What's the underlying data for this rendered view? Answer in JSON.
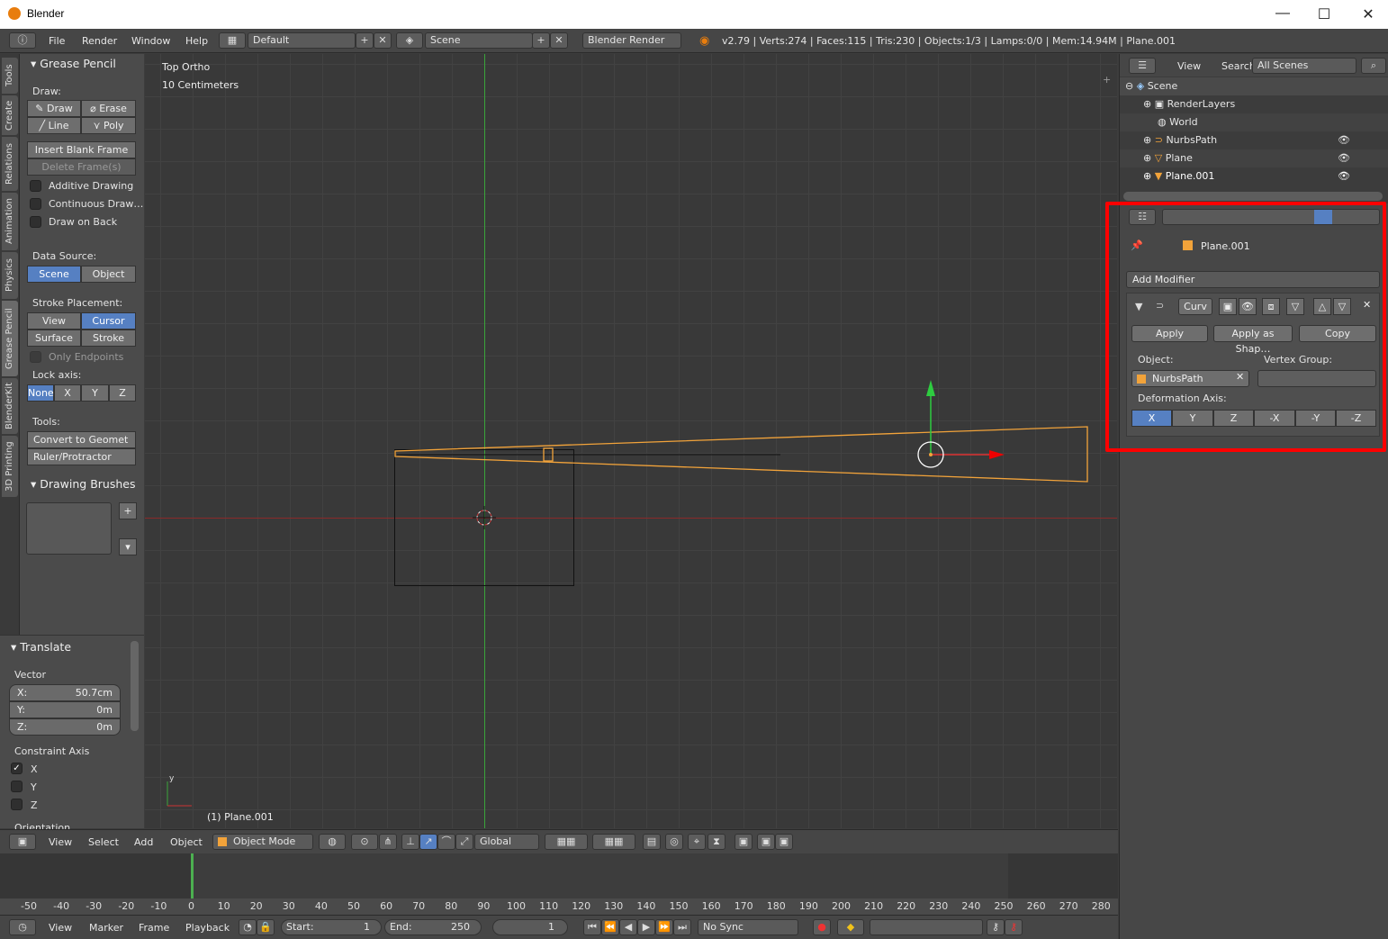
{
  "window": {
    "title": "Blender",
    "min": "—",
    "max": "☐",
    "close": "✕"
  },
  "info": {
    "menus": [
      "File",
      "Render",
      "Window",
      "Help"
    ],
    "layout": "Default",
    "scene": "Scene",
    "engine": "Blender Render",
    "stats": "v2.79 | Verts:274 | Faces:115 | Tris:230 | Objects:1/3 | Lamps:0/0 | Mem:14.94M | Plane.001"
  },
  "tabs": [
    "Tools",
    "Create",
    "Relations",
    "Animation",
    "Physics",
    "Grease Pencil",
    "BlenderKit",
    "3D Printing"
  ],
  "grease": {
    "title": "Grease Pencil",
    "draw_label": "Draw:",
    "draw": "Draw",
    "erase": "Erase",
    "line": "Line",
    "poly": "Poly",
    "insert": "Insert Blank Frame",
    "delete": "Delete Frame(s)",
    "additive": "Additive Drawing",
    "continuous": "Continuous Draw…",
    "drawback": "Draw on Back",
    "datasource": "Data Source:",
    "scene": "Scene",
    "object": "Object",
    "placement": "Stroke Placement:",
    "view": "View",
    "cursor": "Cursor",
    "surface": "Surface",
    "stroke": "Stroke",
    "endpoints": "Only Endpoints",
    "lockaxis": "Lock axis:",
    "none": "None",
    "x": "X",
    "y": "Y",
    "z": "Z",
    "tools": "Tools:",
    "convert": "Convert to Geomet",
    "ruler": "Ruler/Protractor",
    "brushes": "Drawing Brushes"
  },
  "translate": {
    "title": "Translate",
    "vector": "Vector",
    "x": "X:",
    "xv": "50.7cm",
    "y": "Y:",
    "yv": "0m",
    "z": "Z:",
    "zv": "0m",
    "constraint": "Constraint Axis",
    "cx": "X",
    "cy": "Y",
    "cz": "Z",
    "orient": "Orientation"
  },
  "viewport": {
    "view": "Top Ortho",
    "scale": "10 Centimeters",
    "obj": "(1) Plane.001",
    "axis_y": "y"
  },
  "vphead": {
    "menus": [
      "View",
      "Select",
      "Add",
      "Object"
    ],
    "mode": "Object Mode",
    "orient": "Global"
  },
  "timeline": {
    "ticks": [
      "-50",
      "-40",
      "-30",
      "-20",
      "-10",
      "0",
      "10",
      "20",
      "30",
      "40",
      "50",
      "60",
      "70",
      "80",
      "90",
      "100",
      "110",
      "120",
      "130",
      "140",
      "150",
      "160",
      "170",
      "180",
      "190",
      "200",
      "210",
      "220",
      "230",
      "240",
      "250",
      "260",
      "270",
      "280"
    ],
    "menus": [
      "View",
      "Marker",
      "Frame",
      "Playback"
    ],
    "start": "Start:",
    "startv": "1",
    "end": "End:",
    "endv": "250",
    "cur": "1",
    "sync": "No Sync"
  },
  "outliner": {
    "view": "View",
    "search": "Search",
    "scenes": "All Scenes",
    "rows": [
      "Scene",
      "RenderLayers",
      "World",
      "NurbsPath",
      "Plane",
      "Plane.001"
    ]
  },
  "props": {
    "obj": "Plane.001",
    "add": "Add Modifier",
    "modname": "Curv",
    "apply": "Apply",
    "applyshape": "Apply as Shap…",
    "copy": "Copy",
    "object": "Object:",
    "vgroup": "Vertex Group:",
    "objval": "NurbsPath",
    "deform": "Deformation Axis:",
    "axes": [
      "X",
      "Y",
      "Z",
      "-X",
      "-Y",
      "-Z"
    ]
  },
  "colors": {
    "selected": "#5680c2",
    "highlight": "#ff0000",
    "object": "#f2a33a"
  }
}
